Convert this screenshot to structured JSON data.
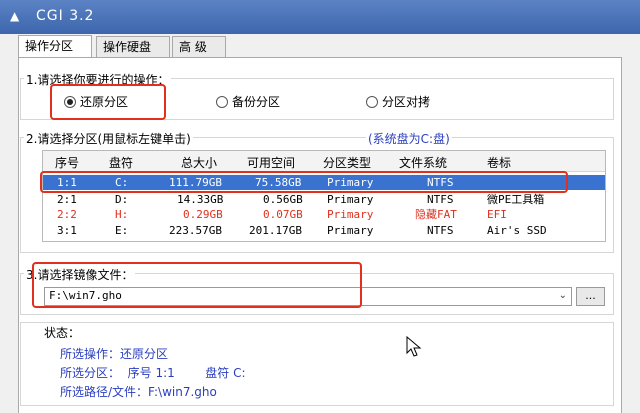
{
  "window": {
    "title": "CGI 3.2",
    "icon": "app-icon"
  },
  "tabs": [
    {
      "label": "操作分区",
      "active": true
    },
    {
      "label": "操作硬盘",
      "active": false
    },
    {
      "label": "高 级",
      "active": false
    }
  ],
  "section1": {
    "label": "1.请选择你要进行的操作：",
    "options": [
      {
        "label": "还原分区",
        "selected": true
      },
      {
        "label": "备份分区",
        "selected": false
      },
      {
        "label": "分区对拷",
        "selected": false
      }
    ]
  },
  "section2": {
    "label": "2.请选择分区(用鼠标左键单击)",
    "system_disk": "(系统盘为C:盘)",
    "columns": [
      "序号",
      "盘符",
      "总大小",
      "可用空间",
      "分区类型",
      "文件系统",
      "卷标"
    ],
    "rows": [
      {
        "index": "1:1",
        "drive": "C:",
        "total": "111.79GB",
        "free": "75.58GB",
        "type": "Primary",
        "fs": "NTFS",
        "label": "",
        "selected": true,
        "hidden": false
      },
      {
        "index": "2:1",
        "drive": "D:",
        "total": "14.33GB",
        "free": "0.56GB",
        "type": "Primary",
        "fs": "NTFS",
        "label": "微PE工具箱",
        "selected": false,
        "hidden": false
      },
      {
        "index": "2:2",
        "drive": "H:",
        "total": "0.29GB",
        "free": "0.07GB",
        "type": "Primary",
        "fs": "隐藏FAT",
        "label": "EFI",
        "selected": false,
        "hidden": true
      },
      {
        "index": "3:1",
        "drive": "E:",
        "total": "223.57GB",
        "free": "201.17GB",
        "type": "Primary",
        "fs": "NTFS",
        "label": "Air's SSD",
        "selected": false,
        "hidden": false
      }
    ]
  },
  "section3": {
    "label": "3.请选择镜像文件：",
    "value": "F:\\win7.gho",
    "browse_label": "..."
  },
  "status": {
    "label": "状态：",
    "operation": "所选操作：还原分区",
    "partition": "所选分区：  序号 1:1        盘符 C:",
    "path": "所选路径/文件：F:\\win7.gho"
  },
  "colors": {
    "selection": "#3a72cf",
    "highlight_box": "#e0301e",
    "accent_text": "#2a3fbf",
    "title_bar": "#4a74b8"
  }
}
